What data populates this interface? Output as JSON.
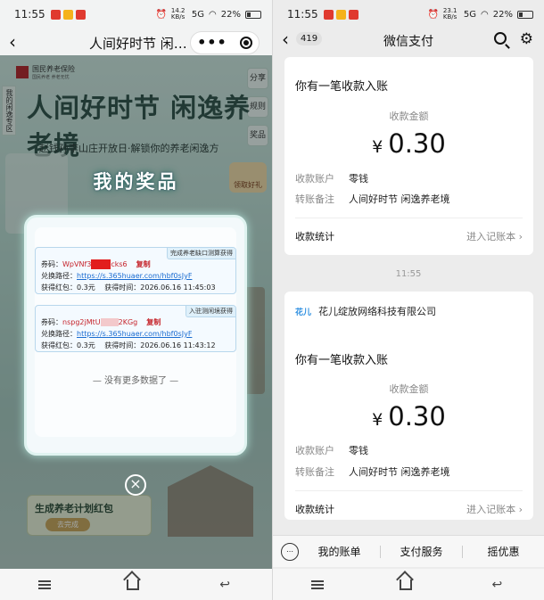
{
  "left": {
    "status": {
      "time": "11:55",
      "speed": "14.2 KB/s",
      "net": "5G",
      "battery": "22%"
    },
    "nav": {
      "back": "‹",
      "title": "人间好时节 闲…"
    },
    "page": {
      "brand": "国民养老保险",
      "brand_sub": "国民养老 养老无忧",
      "side_label": "我的闲逸专区",
      "right_tabs": [
        "分享",
        "规则",
        "奖品"
      ],
      "banner_title": "人间好时节 闲逸养老境",
      "banner_subtitle": "赵钱孙李山庄开放日·解锁你的养老闲逸方",
      "prize_title": "我的奖品",
      "bottom_card_title": "生成养老计划红包",
      "bottom_card_button": "去完成",
      "corner_promo": "领取好礼"
    },
    "modal": {
      "cards": [
        {
          "tag": "完成养老缺口测算获得",
          "code_label": "券码：",
          "code_prefix": "WpVNf3",
          "code_suffix": "cks6",
          "copy": "复制",
          "path_label": "兑换路径：",
          "path_url": "https://s.365huaer.com/hbf0sJyF",
          "amount_label": "获得红包：",
          "amount": "0.3元",
          "time_label": "获得时间：",
          "time": "2026.06.16 11:45:03"
        },
        {
          "tag": "入驻测闲境获得",
          "code_label": "券码：",
          "code_prefix": "nspg2jMtU",
          "code_suffix": "2KGg",
          "copy": "复制",
          "path_label": "兑换路径：",
          "path_url": "https://s.365huaer.com/hbf0sJyF",
          "amount_label": "获得红包：",
          "amount": "0.3元",
          "time_label": "获得时间：",
          "time": "2026.06.16 11:43:12"
        }
      ],
      "no_more": "— 没有更多数据了 —"
    },
    "close_icon": "×"
  },
  "right": {
    "status": {
      "time": "11:55",
      "speed": "23.1 KB/s",
      "net": "5G",
      "battery": "22%"
    },
    "nav": {
      "back": "‹",
      "badge": "419",
      "title": "微信支付"
    },
    "messages": [
      {
        "heading": "你有一笔收款入账",
        "amount_label": "收款金额",
        "currency": "¥",
        "amount": "0.30",
        "account_key": "收款账户",
        "account_val": "零钱",
        "note_key": "转账备注",
        "note_val": "人间好时节 闲逸养老境",
        "stat_label": "收款统计",
        "stat_link": "进入记账本"
      },
      {
        "merchant_logo": "花儿",
        "merchant": "花儿绽放网络科技有限公司",
        "heading": "你有一笔收款入账",
        "amount_label": "收款金额",
        "currency": "¥",
        "amount": "0.30",
        "account_key": "收款账户",
        "account_val": "零钱",
        "note_key": "转账备注",
        "note_val": "人间好时节 闲逸养老境",
        "stat_label": "收款统计",
        "stat_link": "进入记账本"
      }
    ],
    "time_sep": "11:55",
    "tabs": [
      "我的账单",
      "支付服务",
      "摇优惠"
    ]
  }
}
